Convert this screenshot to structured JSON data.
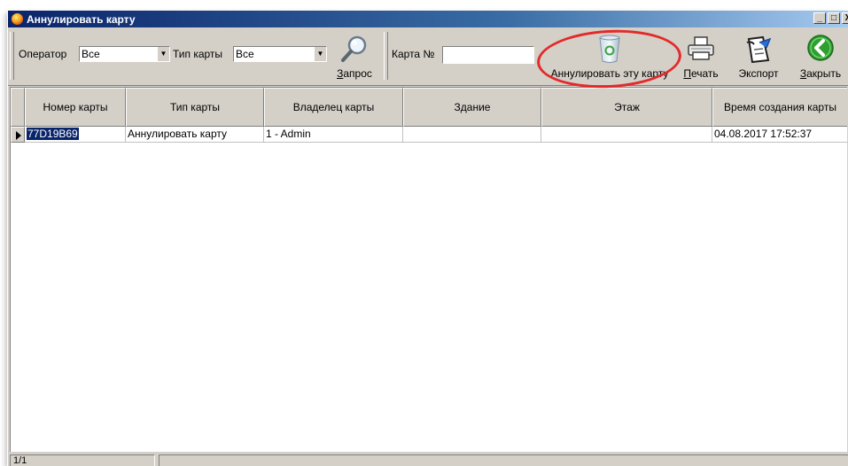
{
  "window": {
    "title": "Аннулировать карту",
    "controls": [
      "_",
      "□",
      "X"
    ]
  },
  "toolbar": {
    "operator_label": "Оператор",
    "operator_value": "Все",
    "card_type_label": "Тип карты",
    "card_type_value": "Все",
    "query_label": "Запрос",
    "card_no_label": "Карта №",
    "card_no_value": "",
    "annul_label": "Аннулировать эту карту",
    "print_label": "Печать",
    "export_label": "Экспорт",
    "close_label": "Закрыть",
    "icons": {
      "query": "magnifier-icon",
      "annul": "recycle-bin-icon",
      "print": "printer-icon",
      "export": "export-document-icon",
      "close": "back-arrow-icon"
    }
  },
  "table": {
    "columns": [
      "Номер карты",
      "Тип карты",
      "Владелец карты",
      "Здание",
      "Этаж",
      "Время создания карты"
    ],
    "rows": [
      [
        "77D19B69",
        "Аннулировать карту",
        "1 - Admin",
        "",
        "",
        "04.08.2017 17:52:37"
      ]
    ]
  },
  "status": {
    "record": "1/1",
    "message": ""
  },
  "colors": {
    "title_start": "#0a246a",
    "title_end": "#a6caf0",
    "face": "#d4d0c8",
    "annotation": "#e32a2a",
    "close_green": "#2fa02f"
  }
}
